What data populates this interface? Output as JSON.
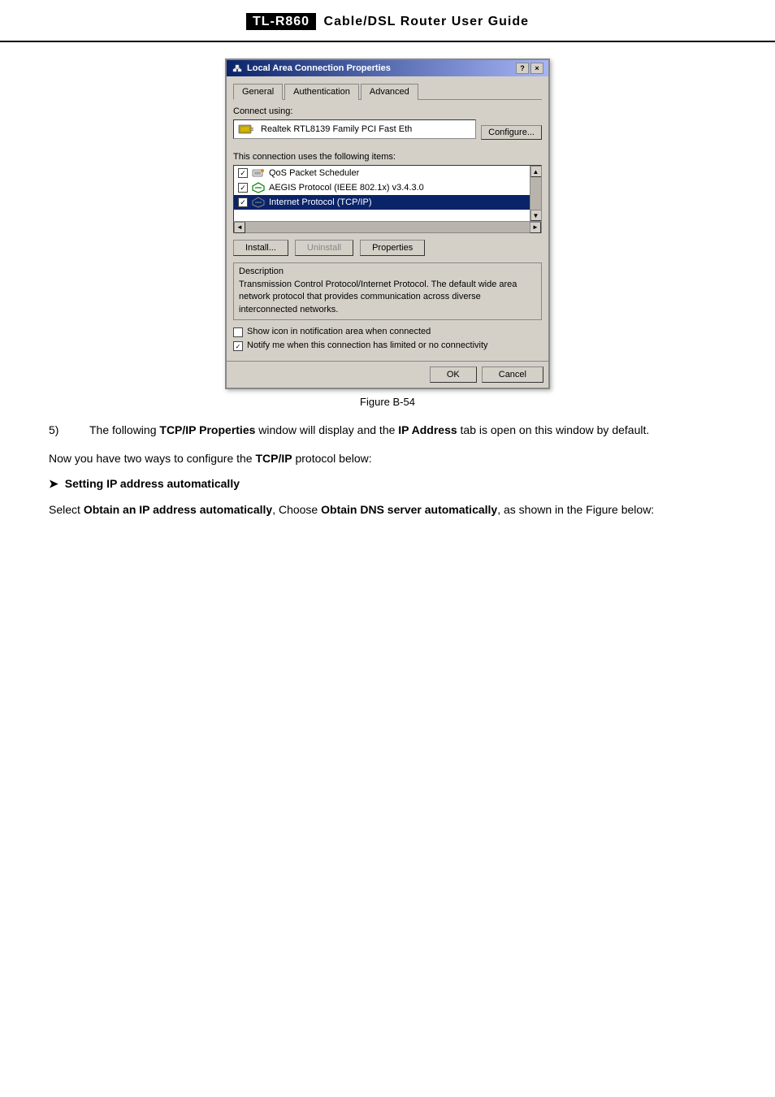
{
  "header": {
    "product": "TL-R860",
    "title": "Cable/DSL  Router  User  Guide"
  },
  "dialog": {
    "title": "Local Area Connection   Properties",
    "help_btn": "?",
    "close_btn": "×",
    "tabs": [
      "General",
      "Authentication",
      "Advanced"
    ],
    "active_tab": "General",
    "connect_using_label": "Connect using:",
    "adapter_name": "Realtek RTL8139 Family PCI Fast Eth",
    "configure_btn": "Configure...",
    "items_label": "This connection uses the following items:",
    "list_items": [
      {
        "checked": true,
        "label": "QoS Packet Scheduler",
        "selected": false
      },
      {
        "checked": true,
        "label": "AEGIS Protocol (IEEE 802.1x) v3.4.3.0",
        "selected": false
      },
      {
        "checked": true,
        "label": "Internet Protocol (TCP/IP)",
        "selected": true
      }
    ],
    "install_btn": "Install...",
    "uninstall_btn": "Uninstall",
    "properties_btn": "Properties",
    "description_group_label": "Description",
    "description_text": "Transmission Control Protocol/Internet Protocol. The default wide area network protocol that provides communication across diverse interconnected networks.",
    "show_icon_checkbox": {
      "checked": false,
      "label": "Show icon in notification area when connected"
    },
    "notify_checkbox": {
      "checked": true,
      "label": "Notify me when this connection has limited or no connectivity"
    },
    "ok_btn": "OK",
    "cancel_btn": "Cancel"
  },
  "figure_caption": "Figure B-54",
  "step5": {
    "number": "5)",
    "text_before": "The following ",
    "bold1": "TCP/IP Properties",
    "text_middle": " window will display and the ",
    "bold2": "IP Address",
    "text_after": " tab is open on this window by default."
  },
  "para1": {
    "text_before": "Now you have two ways to configure the ",
    "bold": "TCP/IP",
    "text_after": " protocol below:"
  },
  "section_heading": "Setting IP address automatically",
  "para2": {
    "text_before": "Select  ",
    "bold1": "Obtain  an  IP  address  automatically",
    "text_middle": ",  Choose  ",
    "bold2": "Obtain  DNS  server automatically",
    "text_after": ", as shown in the Figure below:"
  }
}
